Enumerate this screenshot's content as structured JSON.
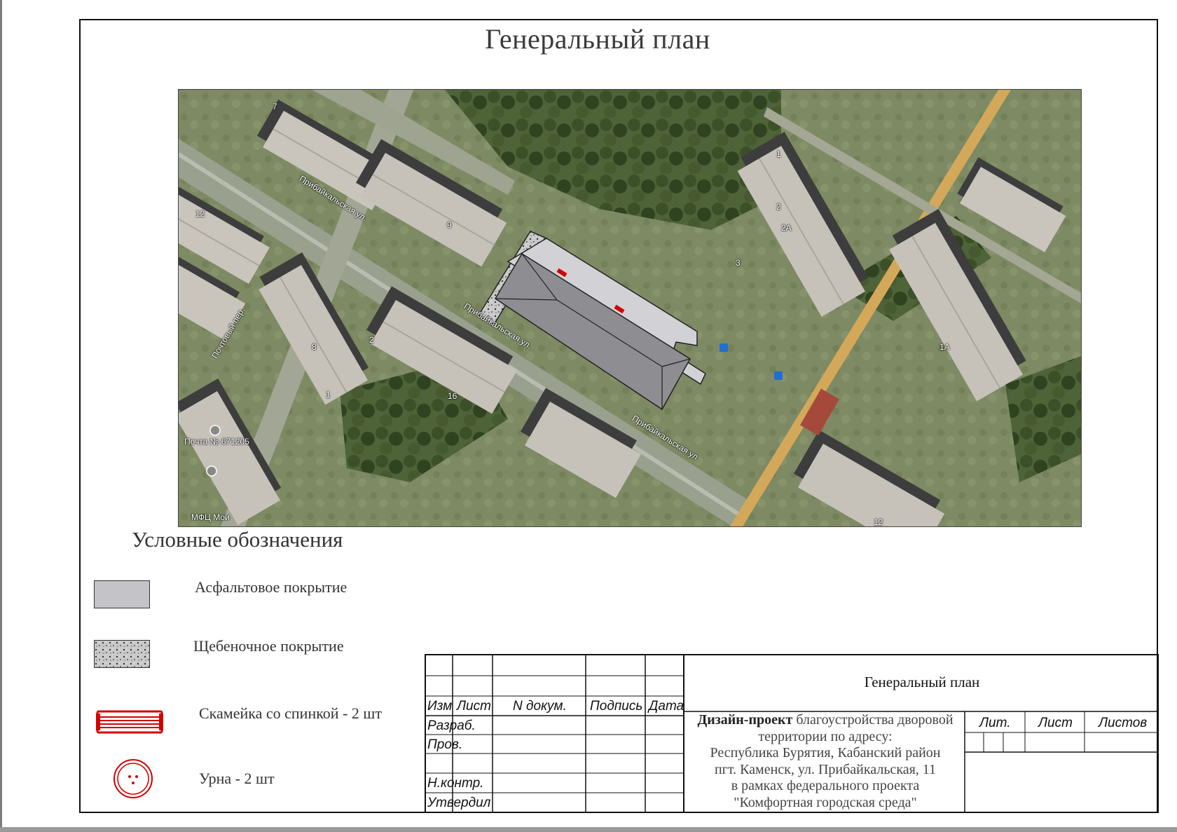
{
  "title": "Генеральный план",
  "map": {
    "streets": [
      "Прибайкальская ул.",
      "Прибайкальская ул.",
      "Прибайкальская ул.",
      "Почтовый пер."
    ],
    "house_numbers": [
      "7",
      "12",
      "9",
      "8",
      "2",
      "1",
      "16",
      "1",
      "2",
      "2А",
      "3",
      "1А",
      "12"
    ],
    "poi": [
      "Почта № 671205",
      "МФЦ Мои"
    ]
  },
  "legend": {
    "title": "Условные обозначения",
    "items": [
      {
        "icon": "asphalt-swatch",
        "label": "Асфальтовое покрытие"
      },
      {
        "icon": "gravel-swatch",
        "label": "Щебеночное покрытие"
      },
      {
        "icon": "bench-icon",
        "label": "Скамейка со спинкой - 2 шт"
      },
      {
        "icon": "urn-icon",
        "label": "Урна - 2 шт"
      }
    ]
  },
  "stamp": {
    "headers": {
      "izm": "Изм",
      "list": "Лист",
      "doc": "N докум.",
      "sign": "Подпись",
      "date": "Дата"
    },
    "roles": [
      "Разраб.",
      "Пров.",
      "",
      "Н.контр.",
      "Утвердил"
    ],
    "sheet_title": "Генеральный план",
    "description_bold": "Дизайн-проект",
    "description_lines": [
      "благоустройства дворовой",
      "территории по адресу:",
      "Республика Бурятия, Кабанский район",
      "пгт. Каменск, ул. Прибайкальская, 11",
      "в рамках федерального проекта",
      "\"Комфортная городская среда\""
    ],
    "lit": "Лит.",
    "sheet": "Лист",
    "sheets": "Листов"
  },
  "colors": {
    "asphalt": "#c4c4c8",
    "bench": "#d40000",
    "urn": "#d40000",
    "road": "#d4a85a"
  }
}
